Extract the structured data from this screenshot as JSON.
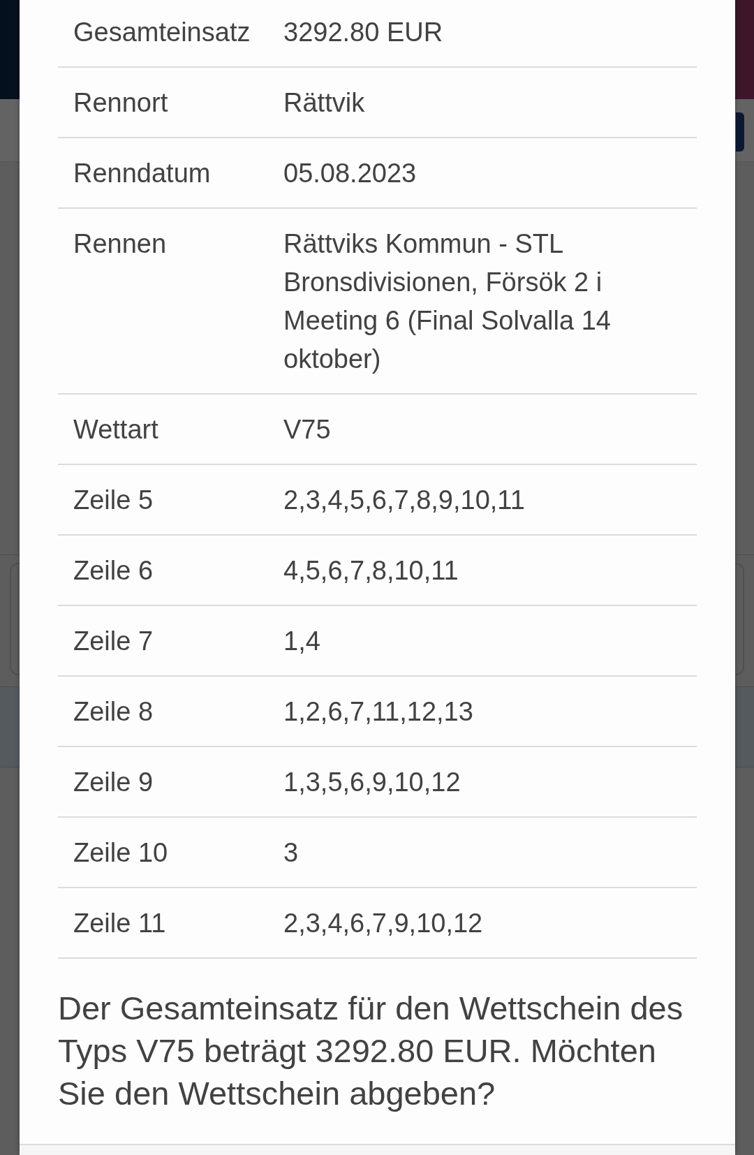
{
  "dialog": {
    "rows": [
      {
        "label": "Gesamteinsatz",
        "value": "3292.80 EUR"
      },
      {
        "label": "Rennort",
        "value": "Rättvik"
      },
      {
        "label": "Renndatum",
        "value": "05.08.2023"
      },
      {
        "label": "Rennen",
        "value": "Rättviks Kommun - STL Bronsdivisionen, Försök 2 i Meeting 6 (Final Solvalla 14 oktober)"
      },
      {
        "label": "Wettart",
        "value": "V75"
      },
      {
        "label": "Zeile 5",
        "value": "2,3,4,5,6,7,8,9,10,11"
      },
      {
        "label": "Zeile 6",
        "value": "4,5,6,7,8,10,11"
      },
      {
        "label": "Zeile 7",
        "value": "1,4"
      },
      {
        "label": "Zeile 8",
        "value": "1,2,6,7,11,12,13"
      },
      {
        "label": "Zeile 9",
        "value": "1,3,5,6,9,10,12"
      },
      {
        "label": "Zeile 10",
        "value": "3"
      },
      {
        "label": "Zeile 11",
        "value": "2,3,4,6,7,9,10,12"
      }
    ],
    "message": "Der Gesamteinsatz für den Wettschein des Typs V75 beträgt 3292.80 EUR. Möchten Sie den Wettschein abgeben?"
  }
}
